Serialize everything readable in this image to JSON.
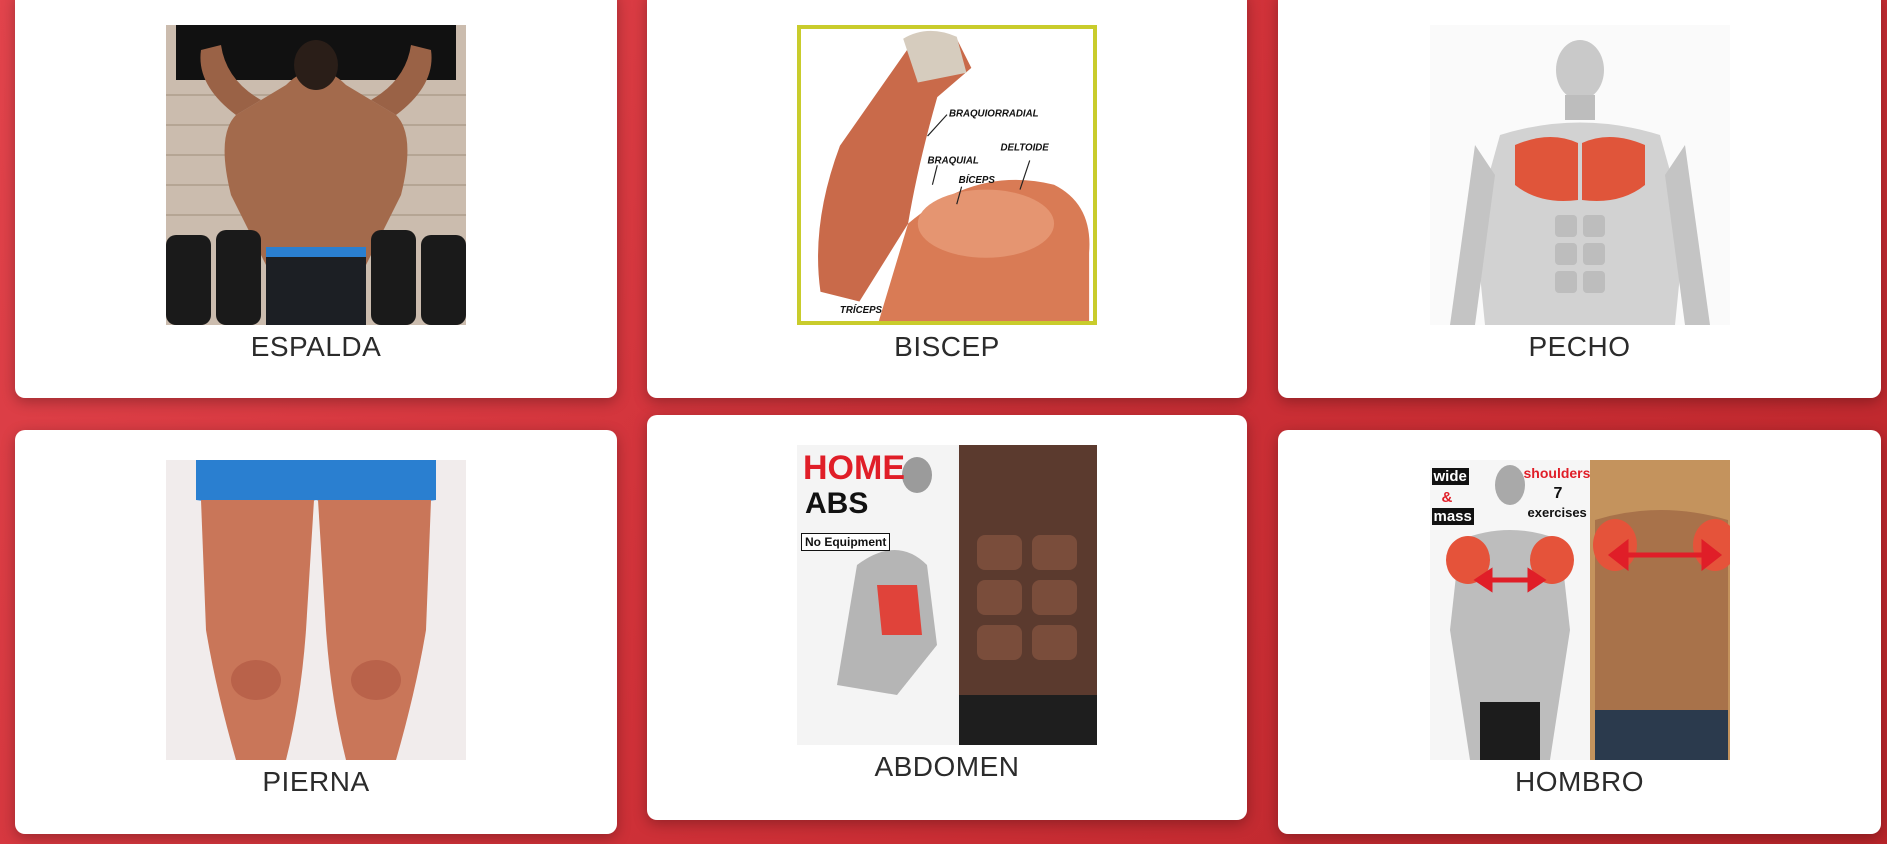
{
  "cards": [
    {
      "label": "ESPALDA"
    },
    {
      "label": "BISCEP",
      "annotations": [
        "BRAQUIORRADIAL",
        "BRAQUIAL",
        "DELTOIDE",
        "BÍCEPS",
        "TRÍCEPS"
      ]
    },
    {
      "label": "PECHO"
    },
    {
      "label": "PIERNA"
    },
    {
      "label": "ABDOMEN",
      "overlay": {
        "line1": "HOME",
        "line2": "ABS",
        "line3": "No Equipment"
      }
    },
    {
      "label": "HOMBRO",
      "overlay": {
        "left1": "wide",
        "left2": "&",
        "left3": "mass",
        "right1": "shoulders",
        "right2": "7",
        "right3": "exercises"
      }
    }
  ],
  "colors": {
    "background": "#d2363d",
    "card": "#ffffff",
    "label": "#2b2b2b",
    "accent_red": "#e01e28"
  }
}
